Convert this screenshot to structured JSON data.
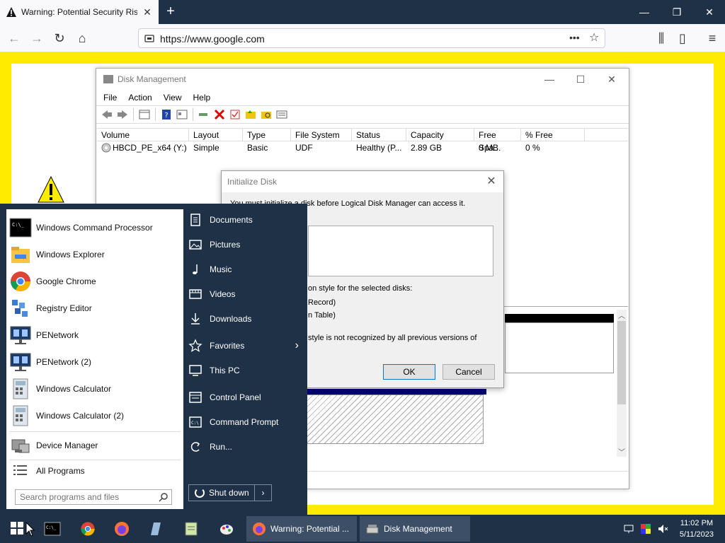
{
  "browser": {
    "tab_title": "Warning: Potential Security Risk Ahead",
    "url": "https://www.google.com"
  },
  "disk_management": {
    "title": "Disk Management",
    "menu": [
      "File",
      "Action",
      "View",
      "Help"
    ],
    "columns": [
      "Volume",
      "Layout",
      "Type",
      "File System",
      "Status",
      "Capacity",
      "Free Spa...",
      "% Free"
    ],
    "row": {
      "volume": "HBCD_PE_x64 (Y:)",
      "layout": "Simple",
      "type": "Basic",
      "file_system": "UDF",
      "status": "Healthy (P...",
      "capacity": "2.89 GB",
      "free": "0 MB",
      "percent_free": "0 %"
    }
  },
  "dialog": {
    "title": "Initialize Disk",
    "message": "You must initialize a disk before Logical Disk Manager can access it.",
    "style_text": "on style for the selected disks:",
    "option1": "Record)",
    "option2": "n Table)",
    "note": "style is not recognized by all previous versions of",
    "ok": "OK",
    "cancel": "Cancel"
  },
  "start_menu": {
    "apps": [
      "Windows Command Processor",
      "Windows Explorer",
      "Google Chrome",
      "Registry Editor",
      "PENetwork",
      "PENetwork (2)",
      "Windows Calculator",
      "Windows Calculator (2)",
      "Device Manager",
      "All Programs"
    ],
    "search_placeholder": "Search programs and files",
    "places": [
      "Documents",
      "Pictures",
      "Music",
      "Videos",
      "Downloads",
      "Favorites",
      "This PC",
      "Control Panel",
      "Command Prompt",
      "Run..."
    ],
    "shutdown": "Shut down"
  },
  "taskbar": {
    "tasks": [
      "Warning: Potential ...",
      "Disk Management"
    ],
    "time": "11:02 PM",
    "date": "5/11/2023"
  },
  "colors": {
    "accent": "#ffeb00",
    "taskbar": "#1f3147"
  }
}
